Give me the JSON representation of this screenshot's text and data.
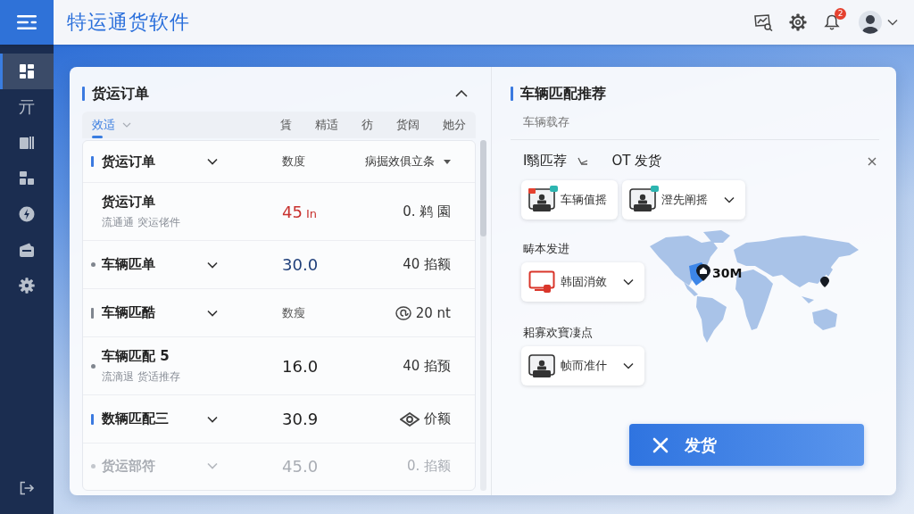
{
  "header": {
    "title": "特运通货软件",
    "notification_count": "2"
  },
  "sidebar": {
    "items": [
      {
        "selected": true
      },
      {
        "selected": false,
        "glyph": "亓"
      },
      {
        "selected": false
      },
      {
        "selected": false
      },
      {
        "selected": false
      },
      {
        "selected": false
      },
      {
        "selected": false
      }
    ]
  },
  "orders_panel": {
    "title": "货运订单",
    "expanded": true,
    "tabs": [
      {
        "label": "效适",
        "selected": true,
        "menu": true
      },
      {
        "label": "賃",
        "selected": false,
        "menu": false
      },
      {
        "label": "精适",
        "selected": false,
        "menu": false
      },
      {
        "label": "彷",
        "selected": false,
        "menu": false
      },
      {
        "label": "货阔",
        "selected": false,
        "menu": false
      },
      {
        "label": "她分",
        "selected": false,
        "menu": false
      }
    ],
    "filter_row": {
      "name": "货运订单",
      "column": "数度",
      "sort": "病掘效俱立条"
    },
    "rows": [
      {
        "name": "货运订单",
        "subtitle": "流通通 突运佬件",
        "expandable": false,
        "value": {
          "text": "45",
          "unit": "In",
          "kind": "number",
          "color": "#c8322f"
        },
        "amount": {
          "text": "0. 鹈 園"
        },
        "faded": false
      },
      {
        "name": "车辆匹单",
        "marker": {
          "kind": "dot",
          "color": "#80868f"
        },
        "expandable": true,
        "value": {
          "text": "30.0",
          "kind": "number",
          "color": "#1f3f7a"
        },
        "amount": {
          "text": "40 掐额"
        },
        "faded": false
      },
      {
        "name": "车辆匹酷",
        "marker": {
          "kind": "bar",
          "color": "#80868f"
        },
        "expandable": true,
        "value": {
          "text": "数瘦",
          "kind": "label",
          "color": "#555555"
        },
        "amount": {
          "kind": "at",
          "text": "20 nt"
        },
        "faded": false
      },
      {
        "name": "车辆匹配 5",
        "subtitle": "流滴退 货适推存",
        "marker": {
          "kind": "dot",
          "color": "#80868f"
        },
        "expandable": false,
        "value": {
          "text": "16.0",
          "kind": "number",
          "color": "#222222"
        },
        "amount": {
          "text": "40 掐预"
        },
        "faded": false
      },
      {
        "name": "数辆匹配三",
        "marker": {
          "kind": "bar",
          "color": "#3b7ae0"
        },
        "expandable": true,
        "value": {
          "text": "30.9",
          "kind": "number",
          "color": "#222222"
        },
        "amount": {
          "kind": "eye",
          "text": "价额"
        },
        "faded": false
      },
      {
        "name": "货运部符",
        "marker": {
          "kind": "dot",
          "color": "#c3c7cd"
        },
        "expandable": true,
        "value": {
          "text": "45.0",
          "kind": "number",
          "color": "#a9adb4"
        },
        "amount": {
          "text": "0. 掐额"
        },
        "faded": true
      }
    ]
  },
  "match_panel": {
    "title": "车辆匹配推荐",
    "subtitle": "车辆载存",
    "match": {
      "label": "I翳匹荐",
      "status": "OT 发货"
    },
    "chips": [
      {
        "label": "车辆值摇",
        "icon": {
          "kind": "driver",
          "color": "#333333"
        },
        "alert_tag": true,
        "new_badge": true,
        "dropdown": false
      },
      {
        "label": "澄先阐摇",
        "icon": {
          "kind": "driver",
          "color": "#333333"
        },
        "alert_tag": false,
        "new_badge": true,
        "dropdown": true
      }
    ],
    "groups": [
      {
        "label": "畴本发进",
        "chip": {
          "label": "韩固消敛",
          "icon": {
            "kind": "monitor",
            "color": "#d9362b"
          },
          "alert_tag": false,
          "new_badge": false,
          "dropdown": true
        }
      },
      {
        "label": "耜寡欢寶凄点",
        "chip": {
          "label": "帧而准什",
          "icon": {
            "kind": "driver",
            "color": "#333333"
          },
          "alert_tag": false,
          "new_badge": false,
          "dropdown": true
        }
      }
    ],
    "map": {
      "marker_label": "30M"
    },
    "action": "发货"
  }
}
